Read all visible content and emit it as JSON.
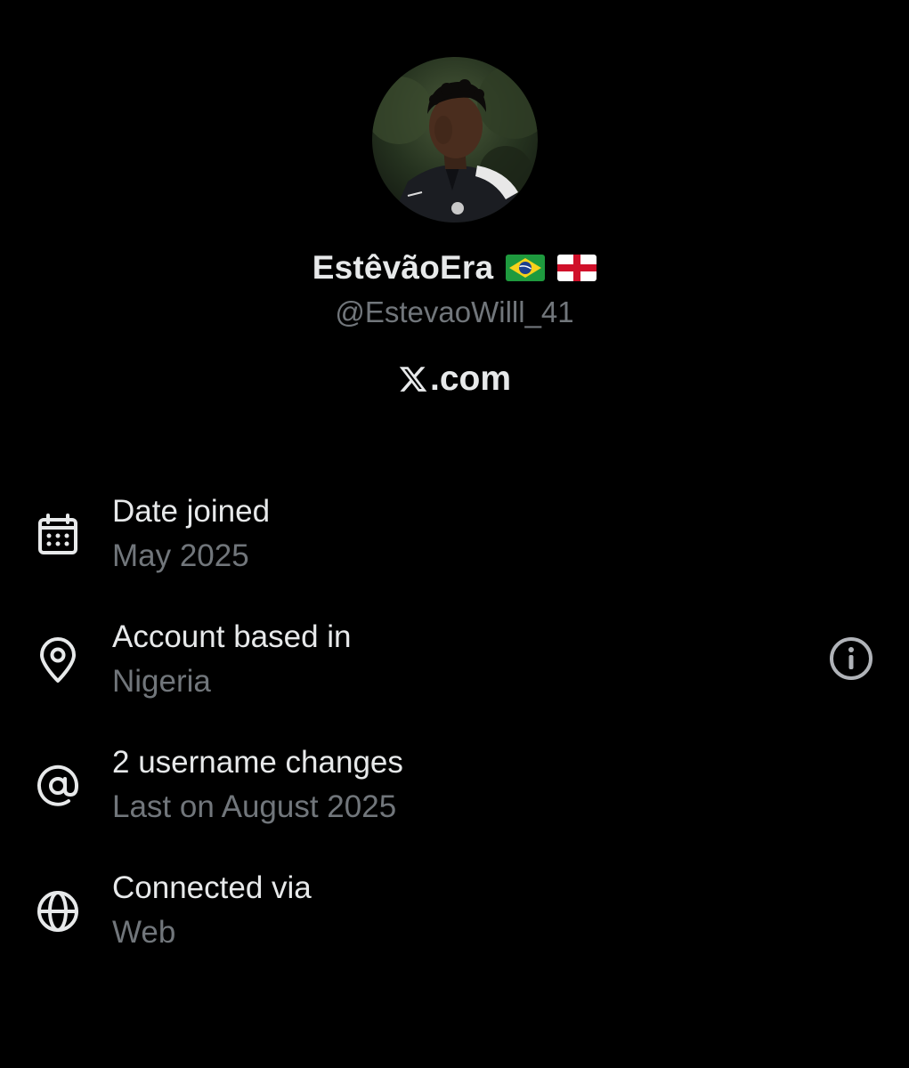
{
  "profile": {
    "display_name": "EstêvãoEra",
    "flags": [
      "brazil-flag",
      "england-flag"
    ],
    "handle": "@EstevaoWilll_41",
    "site": ".com",
    "site_logo": "x-logo-icon"
  },
  "info": [
    {
      "icon": "calendar-icon",
      "title": "Date joined",
      "value": "May 2025"
    },
    {
      "icon": "location-pin-icon",
      "title": "Account based in",
      "value": "Nigeria",
      "action_icon": "info-icon"
    },
    {
      "icon": "at-sign-icon",
      "title": "2 username changes",
      "value": "Last on August 2025"
    },
    {
      "icon": "globe-icon",
      "title": "Connected via",
      "value": "Web"
    }
  ],
  "colors": {
    "background": "#000000",
    "primary_text": "#e7e9ea",
    "secondary_text": "#71767b",
    "icon": "#e7e9ea",
    "info_button": "#b0b3b8"
  }
}
